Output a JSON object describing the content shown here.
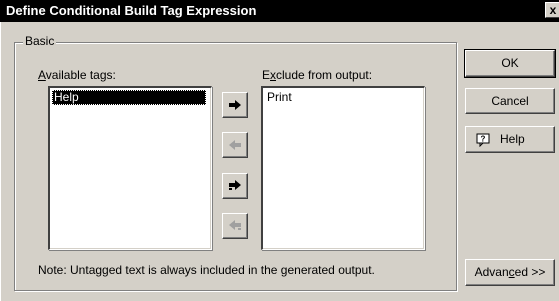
{
  "window": {
    "title": "Define Conditional Build Tag Expression",
    "close_glyph": "x"
  },
  "basic": {
    "legend": "Basic",
    "available_label_prefix": "",
    "available_label_mnemonic": "A",
    "available_label_rest": "vailable tags:",
    "exclude_label_prefix": "E",
    "exclude_label_mnemonic": "x",
    "exclude_label_rest": "clude from output:",
    "available_tags": [
      "Help"
    ],
    "excluded_tags": [
      "Print"
    ],
    "note": "Note: Untagged text is always included in the generated output."
  },
  "buttons": {
    "ok": "OK",
    "cancel": "Cancel",
    "help": "Help",
    "help_icon": "question-balloon-icon",
    "advanced_prefix": "Advan",
    "advanced_mnemonic": "c",
    "advanced_rest": "ed >>"
  },
  "arrows": [
    {
      "name": "move-right-button",
      "icon": "arrow-right-icon",
      "enabled": true
    },
    {
      "name": "move-left-button",
      "icon": "arrow-left-icon",
      "enabled": false
    },
    {
      "name": "move-all-right-button",
      "icon": "double-arrow-right-icon",
      "enabled": true
    },
    {
      "name": "move-all-left-button",
      "icon": "double-arrow-left-icon",
      "enabled": false
    }
  ]
}
